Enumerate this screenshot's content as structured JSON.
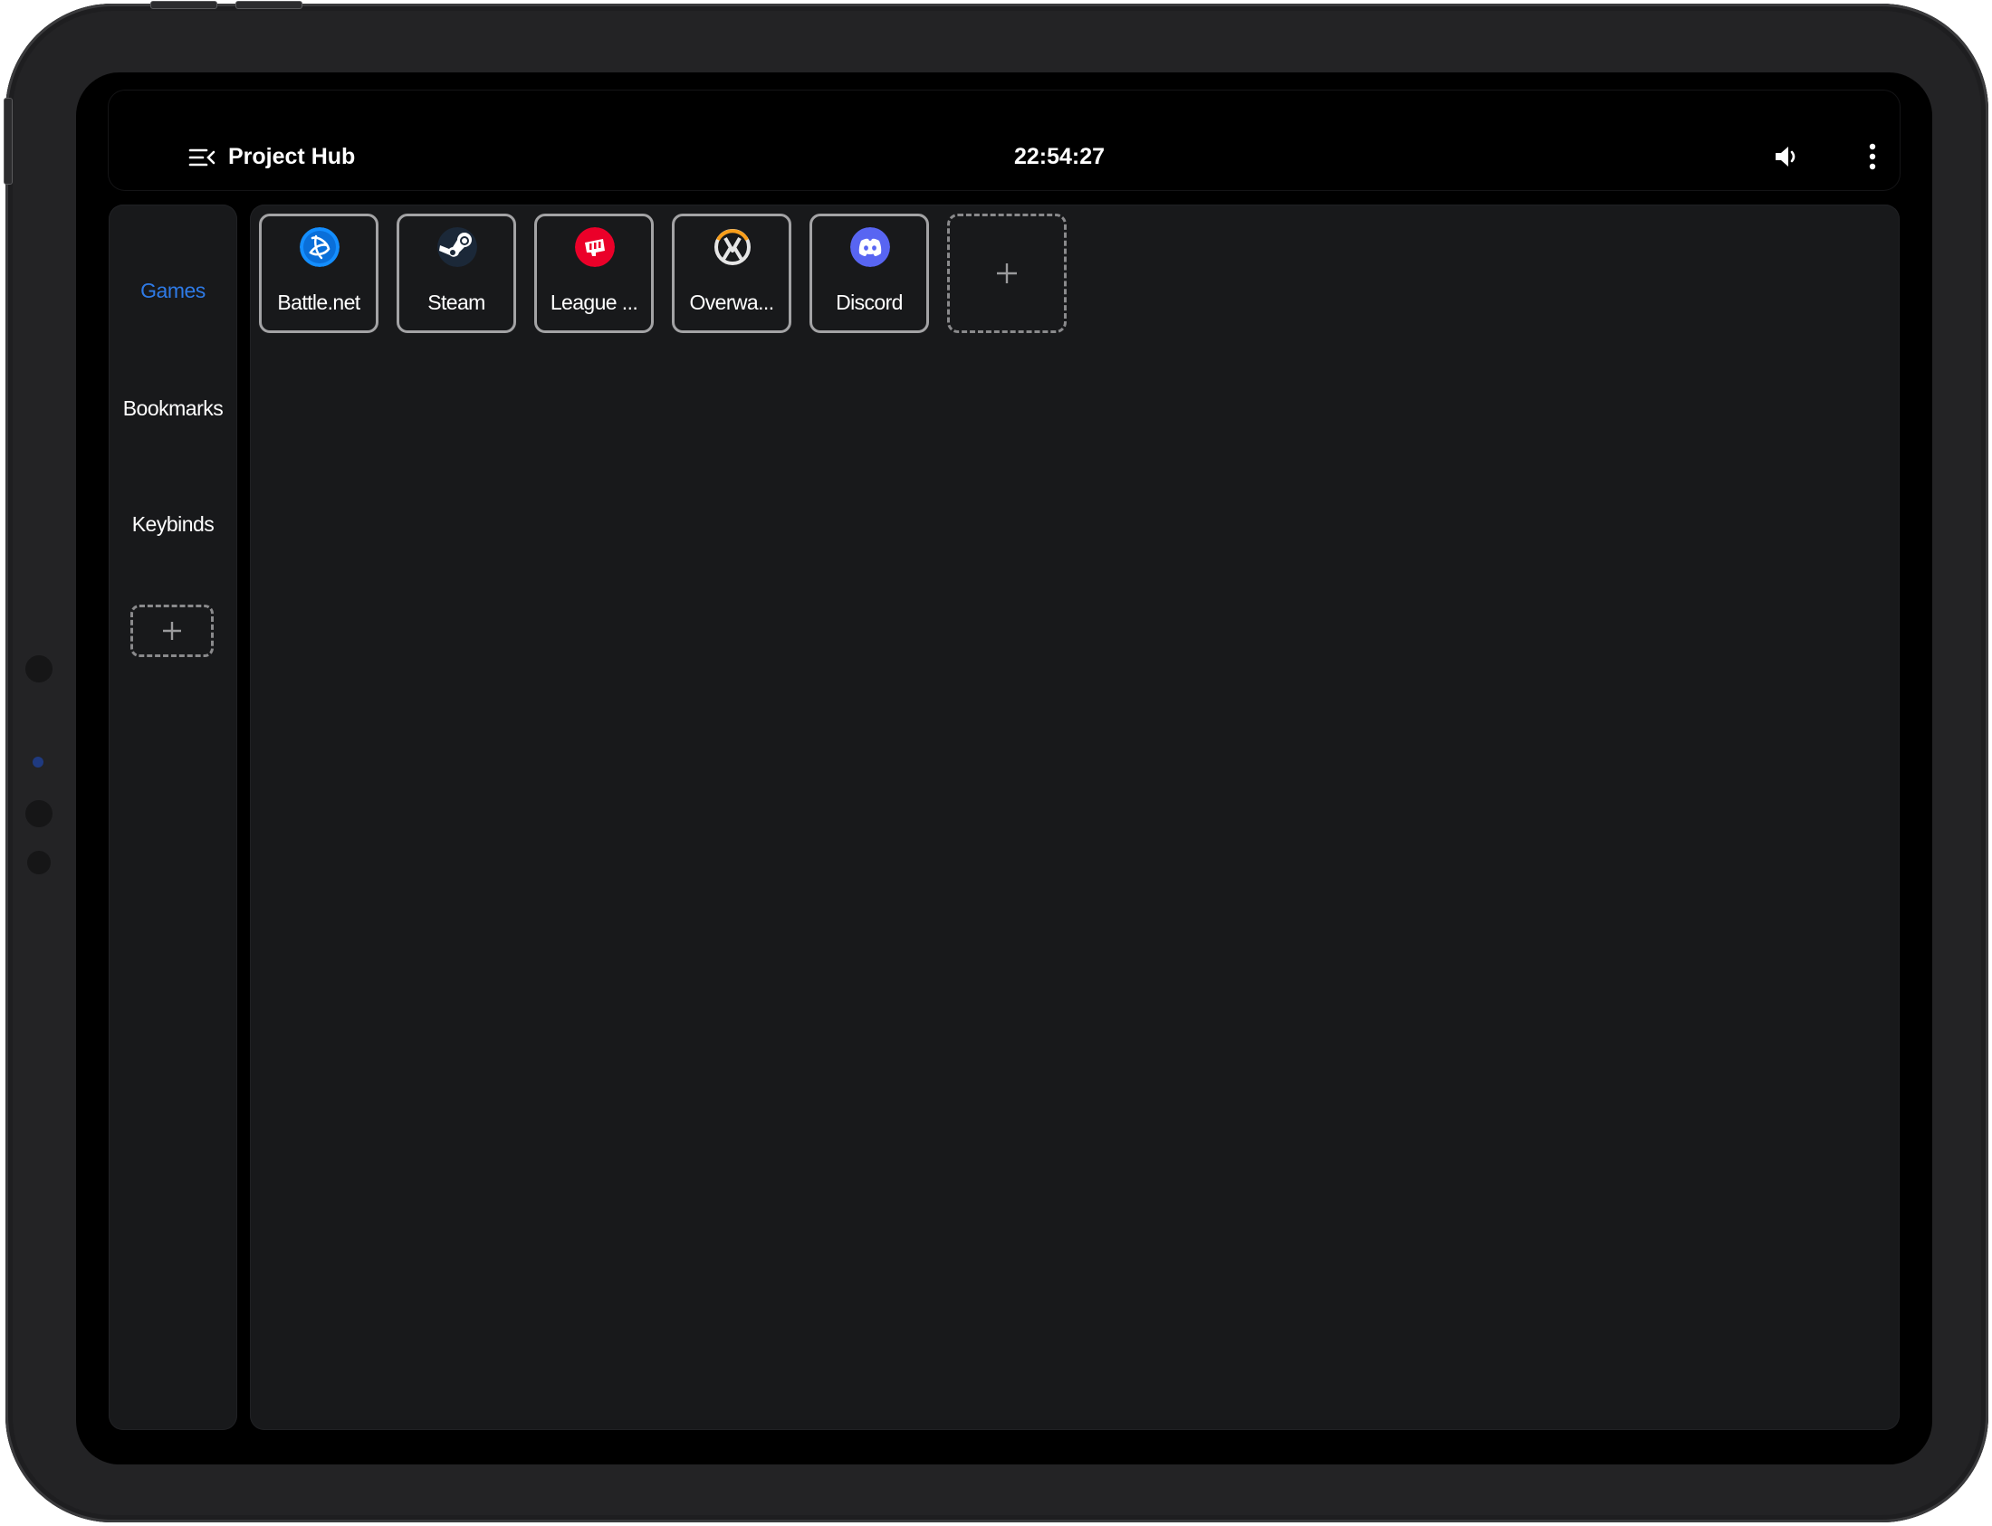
{
  "header": {
    "menu_icon": "menu-collapse-icon",
    "title": "Project Hub",
    "clock": "22:54:27",
    "volume_icon": "volume-icon",
    "more_icon": "more-vertical-icon"
  },
  "sidebar": {
    "items": [
      {
        "label": "Games",
        "active": true
      },
      {
        "label": "Bookmarks",
        "active": false
      },
      {
        "label": "Keybinds",
        "active": false
      }
    ],
    "add_icon": "plus-icon"
  },
  "tiles": [
    {
      "label": "Battle.net",
      "icon": "battlenet-icon",
      "color": "#148EFF"
    },
    {
      "label": "Steam",
      "icon": "steam-icon",
      "color": "#1B2838"
    },
    {
      "label": "League ...",
      "icon": "riot-games-icon",
      "color": "#EB0029"
    },
    {
      "label": "Overwa...",
      "icon": "overwatch-icon",
      "color": "#F99E1A"
    },
    {
      "label": "Discord",
      "icon": "discord-icon",
      "color": "#5865F2"
    }
  ],
  "add_tile_icon": "plus-icon",
  "colors": {
    "accent": "#2e7ae6",
    "panel": "#18191b",
    "tile_border": "#a3a3a5"
  }
}
